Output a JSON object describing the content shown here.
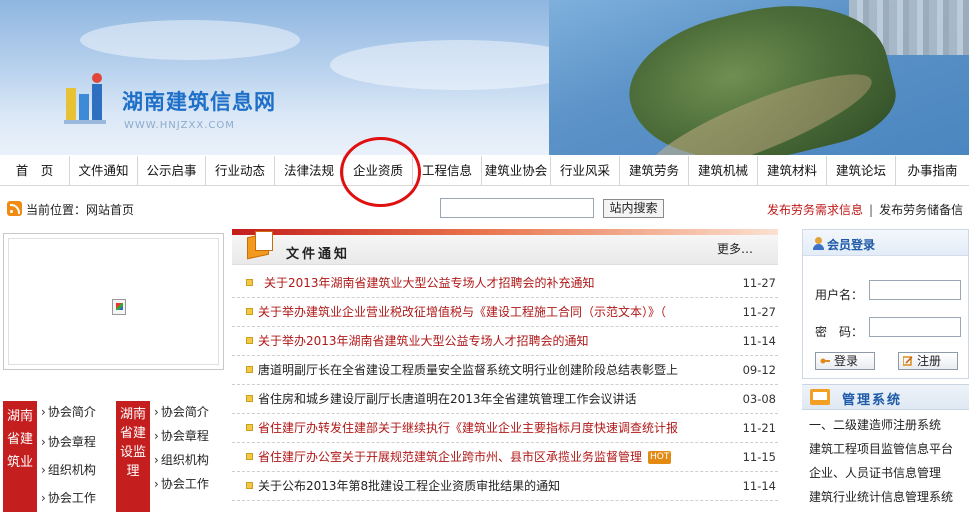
{
  "header": {
    "site_name": "湖南建筑信息网",
    "site_url": "WWW.HNJZXX.COM"
  },
  "nav": {
    "items": [
      "首　页",
      "文件通知",
      "公示启事",
      "行业动态",
      "法律法规",
      "企业资质",
      "工程信息",
      "建筑业协会",
      "行业风采",
      "建筑劳务",
      "建筑机械",
      "建筑材料",
      "建筑论坛",
      "办事指南"
    ]
  },
  "location": {
    "label": "当前位置：网站首页",
    "search_button": "站内搜索",
    "link1": "发布劳务需求信息",
    "separator": "|",
    "link2": "发布劳务储备信"
  },
  "assoc1": {
    "title": "湖南省建筑业",
    "items": [
      "协会简介",
      "协会章程",
      "组织机构",
      "协会工作"
    ]
  },
  "assoc2": {
    "title": "湖南省建设监理",
    "items": [
      "协会简介",
      "协会章程",
      "组织机构",
      "协会工作"
    ]
  },
  "notices": {
    "title": "文件通知",
    "more": "更多…",
    "items": [
      {
        "title": "关于2013年湖南省建筑业大型公益专场人才招聘会的补充通知",
        "date": "11-27"
      },
      {
        "title": "关于举办建筑业企业营业税改征增值税与《建设工程施工合同（示范文本）》（",
        "date": "11-27"
      },
      {
        "title": "关于举办2013年湖南省建筑业大型公益专场人才招聘会的通知",
        "date": "11-14"
      },
      {
        "title": "唐道明副厅长在全省建设工程质量安全监督系统文明行业创建阶段总结表彰暨上",
        "date": "09-12"
      },
      {
        "title": "省住房和城乡建设厅副厅长唐道明在2013年全省建筑管理工作会议讲话",
        "date": "03-08"
      },
      {
        "title": "省住建厅办转发住建部关于继续执行《建筑业企业主要指标月度快速调查统计报",
        "date": "11-21"
      },
      {
        "title": "省住建厅办公室关于开展规范建筑企业跨市州、县市区承揽业务监督管理",
        "date": "11-15",
        "badge": "HOT"
      },
      {
        "title": "关于公布2013年第8批建设工程企业资质审批结果的通知",
        "date": "11-14"
      }
    ]
  },
  "login": {
    "title": "会员登录",
    "username_label": "用户名：",
    "password_label": "密　码：",
    "login_button": "登录",
    "register_button": "注册"
  },
  "management": {
    "title": "管理系统",
    "items": [
      "一、二级建造师注册系统",
      "建筑工程项目监管信息平台",
      "企业、人员证书信息管理",
      "建筑行业统计信息管理系统"
    ]
  }
}
